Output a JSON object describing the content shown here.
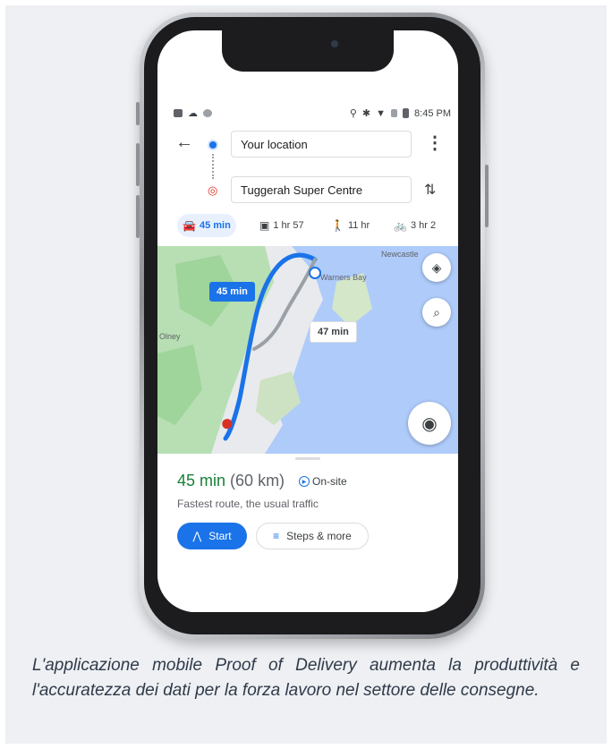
{
  "status_bar": {
    "time": "8:45 PM"
  },
  "directions": {
    "origin": "Your location",
    "destination": "Tuggerah Super Centre"
  },
  "modes": [
    {
      "icon": "car-icon",
      "label": "45 min"
    },
    {
      "icon": "transit-icon",
      "label": "1 hr 57"
    },
    {
      "icon": "walk-icon",
      "label": "11 hr"
    },
    {
      "icon": "bike-icon",
      "label": "3 hr 2"
    }
  ],
  "map": {
    "primary_route_label": "45 min",
    "alt_route_label": "47 min",
    "place_labels": [
      "Newcastle",
      "Warners Bay",
      "Olney"
    ]
  },
  "sheet": {
    "duration": "45 min",
    "distance": "(60 km)",
    "ontime_label": "On-site",
    "route_description": "Fastest route, the usual traffic",
    "start_label": "Start",
    "steps_label": "Steps & more"
  },
  "caption": "L'applicazione mobile Proof of Delivery aumenta la produttività e l'accuratezza dei dati per la forza lavoro nel settore delle consegne.",
  "colors": {
    "accent": "#1a73e8",
    "eta_green": "#188038",
    "water": "#aecbfa",
    "land": "#e8eaed",
    "park": "#b7dfb3"
  }
}
